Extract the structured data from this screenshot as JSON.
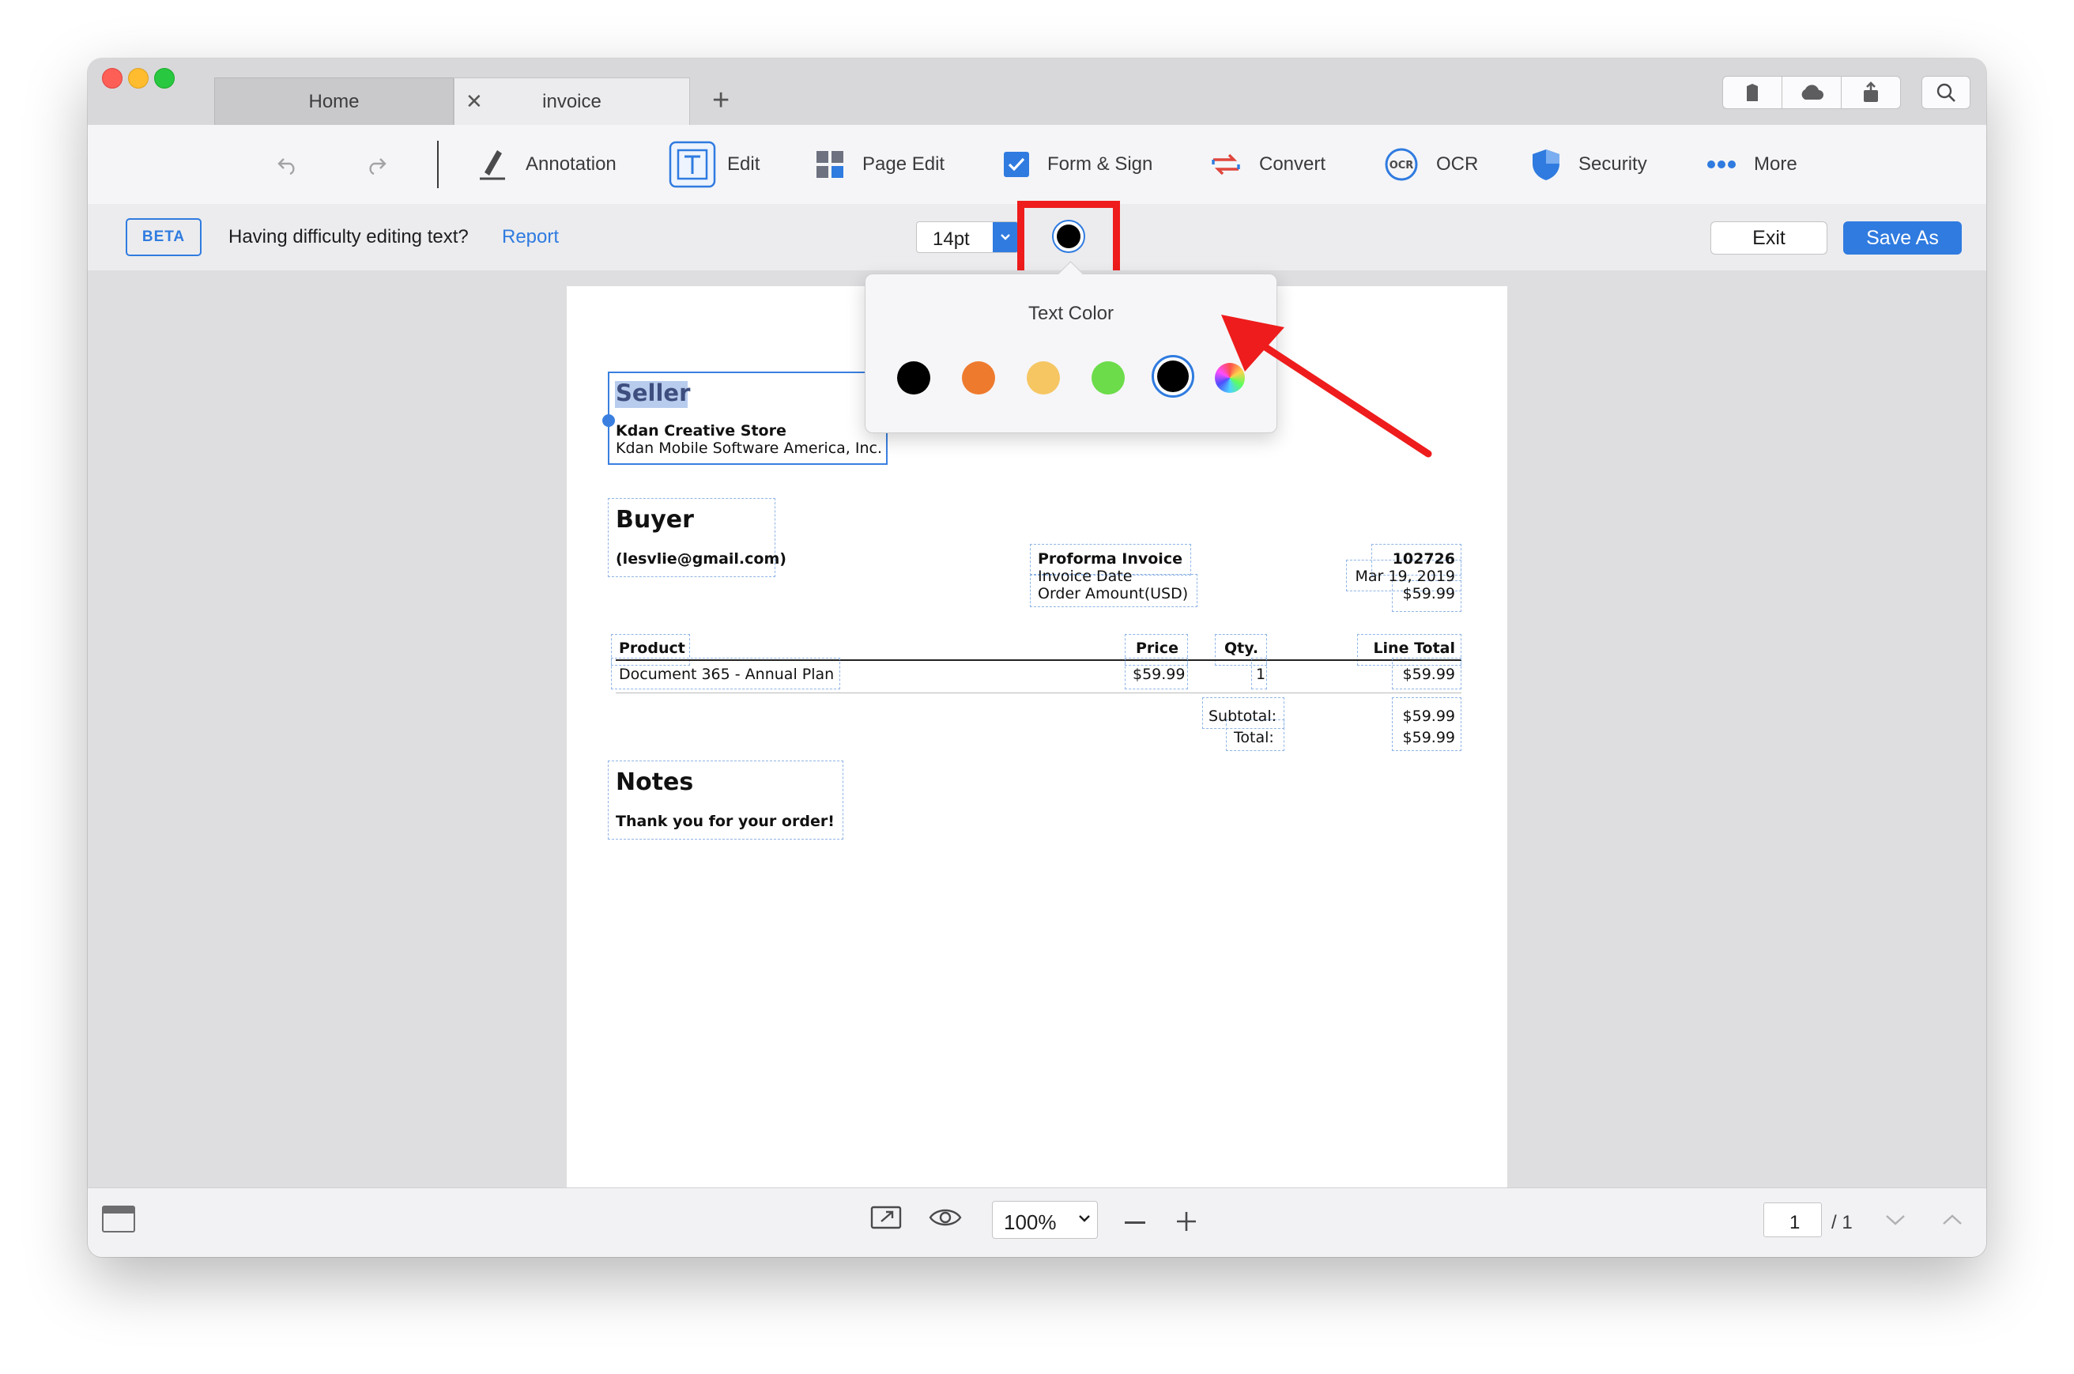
{
  "tabs": {
    "home": "Home",
    "invoice": "invoice"
  },
  "toolbar": {
    "annotation": "Annotation",
    "edit": "Edit",
    "page_edit": "Page Edit",
    "form_sign": "Form & Sign",
    "convert": "Convert",
    "ocr": "OCR",
    "security": "Security",
    "more": "More"
  },
  "icons": {
    "tab_close": "close-icon",
    "new_tab": "plus-icon",
    "titlebar": [
      "bookmark-icon",
      "cloud-icon",
      "share-icon",
      "search-icon"
    ],
    "toolbar": [
      "undo-icon",
      "redo-icon",
      "annotation-pen-icon",
      "edit-text-icon",
      "page-edit-grid-icon",
      "form-checkbox-icon",
      "convert-arrows-icon",
      "ocr-icon",
      "security-shield-icon",
      "more-dots-icon"
    ],
    "status": [
      "sidebar-panel-icon",
      "fit-page-icon",
      "eye-icon",
      "chevron-down-icon",
      "minus-icon",
      "plus-icon",
      "chevron-down-icon",
      "chevron-up-icon"
    ]
  },
  "edit_bar": {
    "beta": "BETA",
    "message": "Having difficulty editing text?",
    "report_link": "Report",
    "font_size": "14pt",
    "exit": "Exit",
    "save_as": "Save As"
  },
  "text_color_popover": {
    "title": "Text Color",
    "swatches": [
      "#000000",
      "#ee7a2e",
      "#f6c663",
      "#6cdc4a",
      "#000000"
    ],
    "selected_index": 4
  },
  "invoice": {
    "seller_heading": "Seller",
    "seller_name": "Kdan Creative Store",
    "seller_company": "Kdan Mobile Software America, Inc.",
    "buyer_heading": "Buyer",
    "buyer_email": "(lesvlie@gmail.com)",
    "proforma_label": "Proforma Invoice",
    "invoice_date_label": "Invoice Date",
    "order_amount_label": "Order Amount(USD)",
    "invoice_number": "102726",
    "invoice_date": "Mar 19, 2019",
    "order_amount": "$59.99",
    "columns": {
      "product": "Product",
      "price": "Price",
      "qty": "Qty.",
      "line_total": "Line Total"
    },
    "row": {
      "product": "Document 365 - Annual Plan",
      "price": "$59.99",
      "qty": "1",
      "line_total": "$59.99"
    },
    "subtotal_label": "Subtotal:",
    "total_label": "Total:",
    "subtotal": "$59.99",
    "total": "$59.99",
    "notes_heading": "Notes",
    "notes_text": "Thank you for your order!"
  },
  "status": {
    "zoom": "100%",
    "page_current": "1",
    "page_total": "/ 1"
  }
}
